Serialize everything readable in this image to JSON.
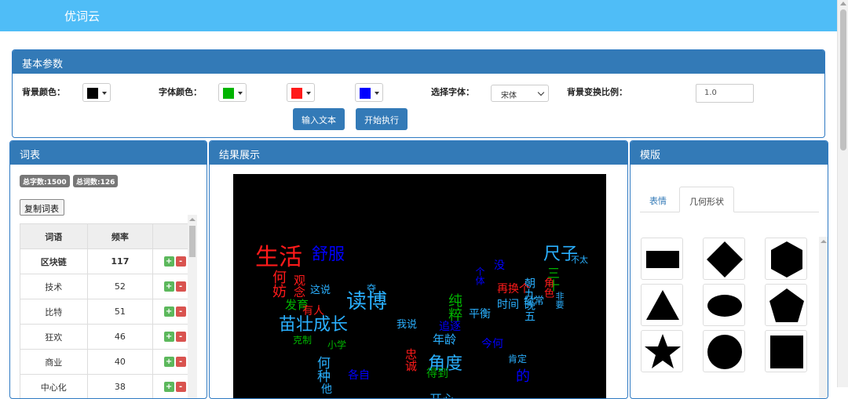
{
  "app": {
    "title": "优词云"
  },
  "params": {
    "title": "基本参数",
    "bg_color_label": "背景颜色：",
    "font_color_label": "字体颜色：",
    "font_select_label": "选择字体：",
    "font_value": "宋体",
    "ratio_label": "背景变换比例：",
    "ratio_value": "1.0",
    "input_text_button": "输入文本",
    "run_button": "开始执行",
    "colors": {
      "background": "#000000",
      "font1": "#00b400",
      "font2": "#ff1a1a",
      "font3": "#0000ff"
    }
  },
  "words_panel": {
    "title": "词表",
    "total_chars": "总字数:1500",
    "total_words": "总词数:126",
    "copy_button": "复制词表",
    "headers": [
      "词语",
      "频率",
      ""
    ],
    "rows": [
      {
        "word": "区块链",
        "freq": "117"
      },
      {
        "word": "技术",
        "freq": "52"
      },
      {
        "word": "比特",
        "freq": "51"
      },
      {
        "word": "狂欢",
        "freq": "46"
      },
      {
        "word": "商业",
        "freq": "40"
      },
      {
        "word": "中心化",
        "freq": "38"
      }
    ],
    "plus": "+",
    "minus": "-"
  },
  "result_panel": {
    "title": "结果展示"
  },
  "template_panel": {
    "title": "模版",
    "tabs": [
      "表情",
      "几何形状"
    ],
    "active_tab": "几何形状",
    "shapes": [
      "rectangle",
      "diamond",
      "hexagon",
      "triangle",
      "ellipse",
      "pentagon",
      "star",
      "circle",
      "square"
    ]
  },
  "cloud_words": [
    "生活",
    "舒服",
    "何妨",
    "读博",
    "苗壮成长",
    "尺子",
    "观念",
    "发育",
    "有人",
    "这说",
    "克制",
    "三十",
    "朝九晚五",
    "非要",
    "再换个",
    "纯粹",
    "角度",
    "何种",
    "年龄",
    "我说",
    "追逐",
    "个体",
    "时间",
    "经常",
    "肯定",
    "忠诚",
    "今何",
    "角色",
    "不太",
    "平衡",
    "小学",
    "开心",
    "得到",
    "各自",
    "没",
    "夺",
    "的",
    "他"
  ]
}
